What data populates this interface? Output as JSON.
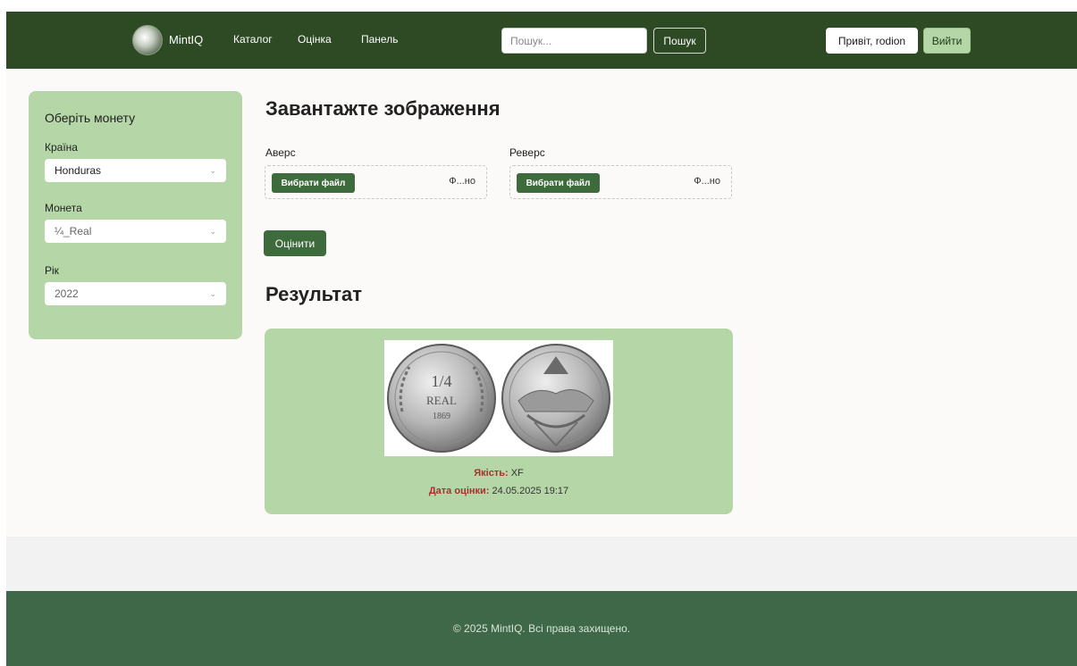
{
  "header": {
    "brand": "MintIQ",
    "nav": [
      "Каталог",
      "Оцінка",
      "Панель"
    ],
    "search_placeholder": "Пошук...",
    "search_button": "Пошук",
    "greeting": "Привіт, rodion",
    "logout": "Вийти"
  },
  "sidebar": {
    "title": "Оберіть монету",
    "country_label": "Країна",
    "country_value": "Honduras",
    "coin_label": "Монета",
    "coin_value": "¼_Real",
    "year_label": "Рік",
    "year_value": "2022"
  },
  "upload": {
    "heading": "Завантажте зображення",
    "obverse_label": "Аверс",
    "reverse_label": "Реверс",
    "choose_file": "Вибрати файл",
    "file_status": "Ф...но",
    "rate_button": "Оцінити"
  },
  "result": {
    "heading": "Результат",
    "quality_label": "Якість:",
    "quality_value": "XF",
    "date_label": "Дата оцінки:",
    "date_value": "24.05.2025 19:17",
    "coin_obverse_text": [
      "1/4",
      "REAL",
      "1869"
    ]
  },
  "footer": {
    "copyright": "© 2025 MintIQ. Всі права захищено."
  }
}
